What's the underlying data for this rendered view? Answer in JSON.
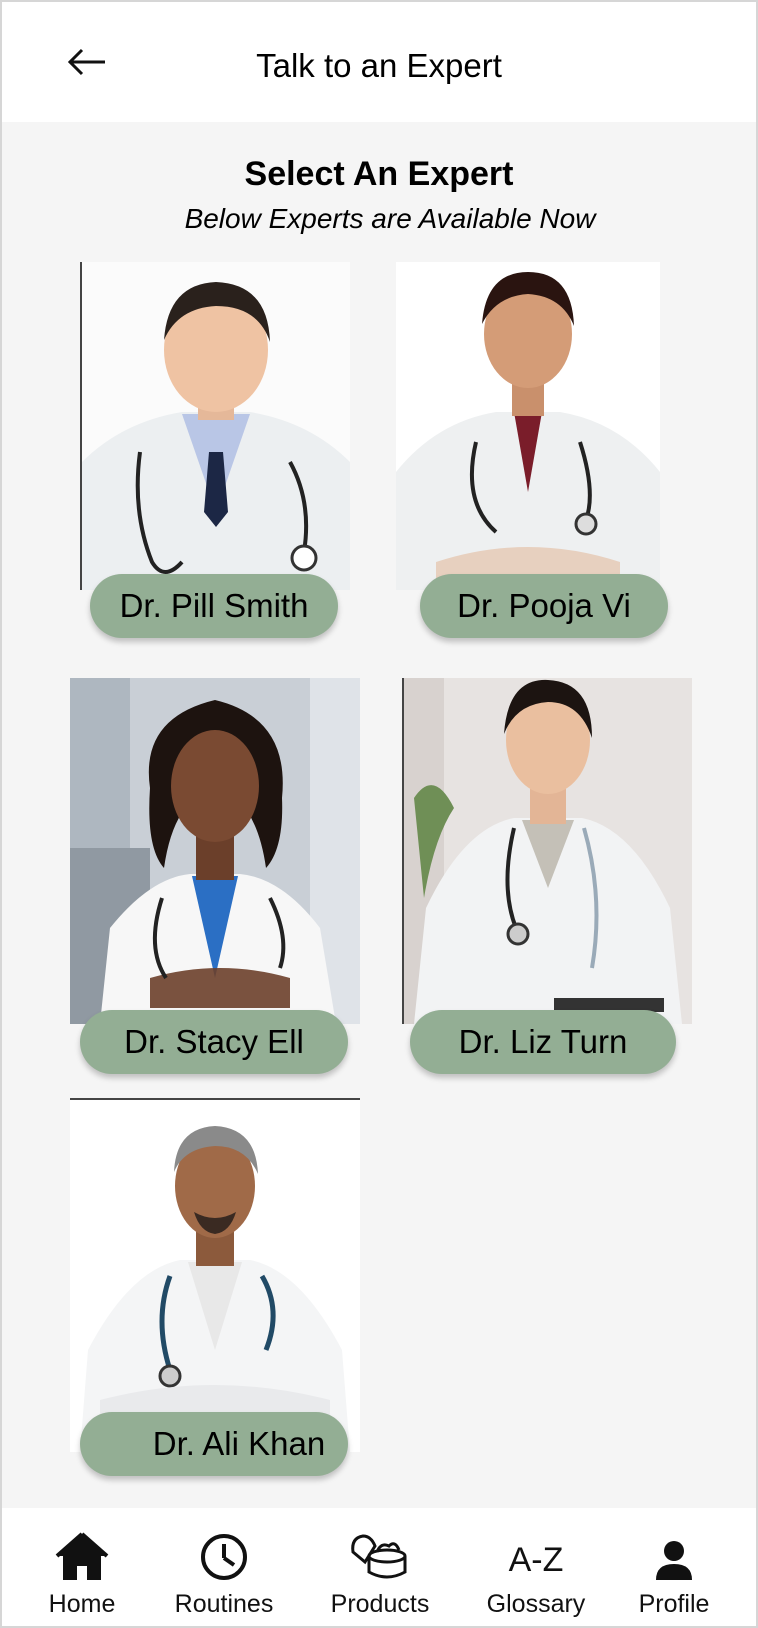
{
  "header": {
    "title": "Talk to an Expert",
    "back_icon": "arrow-left-icon"
  },
  "intro": {
    "title": "Select An Expert",
    "subtitle": "Below Experts are Available Now"
  },
  "experts": [
    {
      "name": "Dr. Pill Smith"
    },
    {
      "name": "Dr. Pooja Vi"
    },
    {
      "name": "Dr. Stacy Ell"
    },
    {
      "name": "Dr. Liz Turn"
    },
    {
      "name": "Dr. Ali Khan"
    }
  ],
  "nav": {
    "items": [
      {
        "label": "Home",
        "icon": "home-icon"
      },
      {
        "label": "Routines",
        "icon": "clock-icon"
      },
      {
        "label": "Products",
        "icon": "products-icon"
      },
      {
        "label": "Glossary",
        "icon": "a-z-icon",
        "glyph": "A-Z"
      },
      {
        "label": "Profile",
        "icon": "profile-icon"
      }
    ]
  },
  "colors": {
    "pill": "#93ae94",
    "background": "#f5f5f5",
    "header": "#ffffff"
  }
}
